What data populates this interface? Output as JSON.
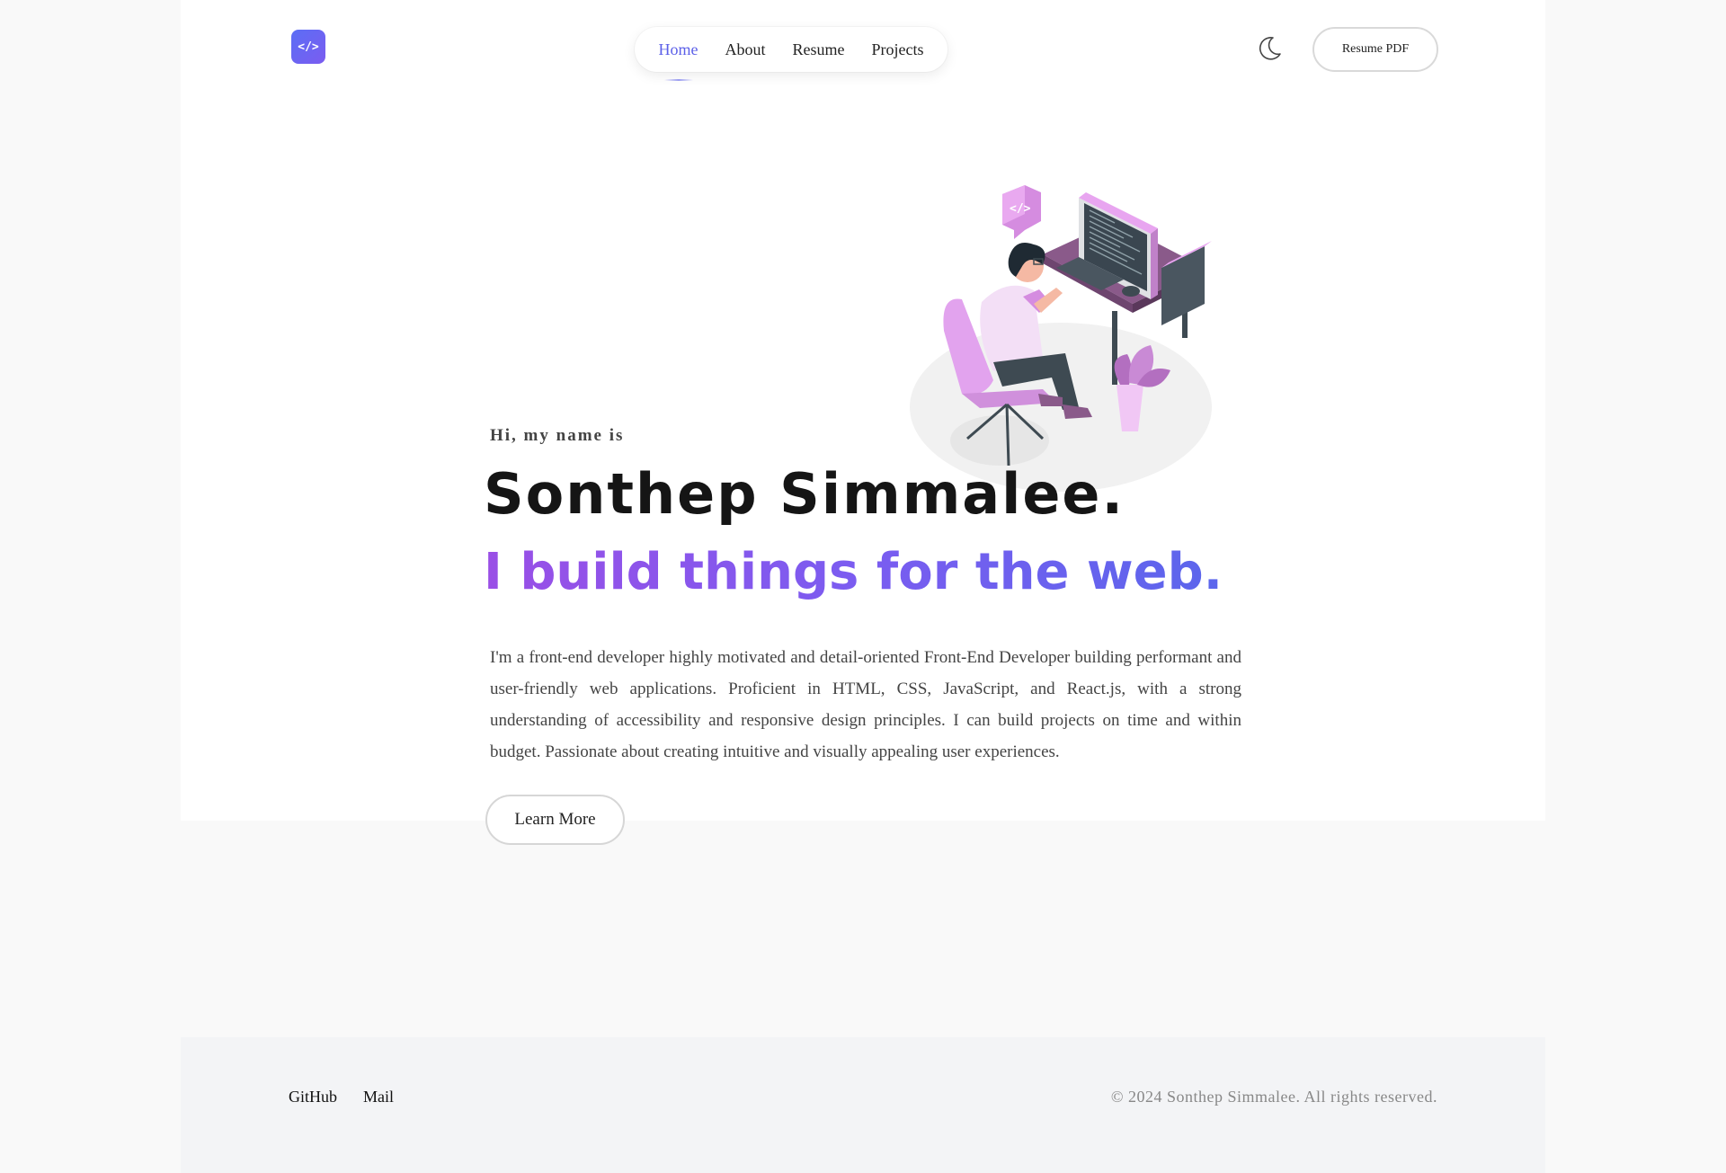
{
  "header": {
    "logo_glyph": "</>",
    "nav": [
      {
        "label": "Home",
        "active": true
      },
      {
        "label": "About",
        "active": false
      },
      {
        "label": "Resume",
        "active": false
      },
      {
        "label": "Projects",
        "active": false
      }
    ],
    "theme_toggle_icon": "moon-icon",
    "resume_button": "Resume PDF"
  },
  "hero": {
    "greeting": "Hi, my name is",
    "name": "Sonthep Simmalee.",
    "tagline": "I build things for the web.",
    "bio": "I'm a front-end developer highly motivated and detail-oriented Front-End Developer building performant and user-friendly web applications. Proficient in HTML, CSS, JavaScript, and React.js, with a strong understanding of accessibility and responsive design principles. I can build projects on time and within budget. Passionate about creating intuitive and visually appealing user experiences.",
    "cta": "Learn More",
    "illustration": "developer-at-desk-illustration"
  },
  "footer": {
    "links": [
      "GitHub",
      "Mail"
    ],
    "copyright": "© 2024 Sonthep Simmalee. All rights reserved."
  },
  "colors": {
    "accent": "#5b5fe8",
    "gradient_start": "#9a4fe6",
    "gradient_end": "#5b66ec",
    "illustration_purple": "#e2a3ee",
    "desk": "#8a5a8a"
  }
}
